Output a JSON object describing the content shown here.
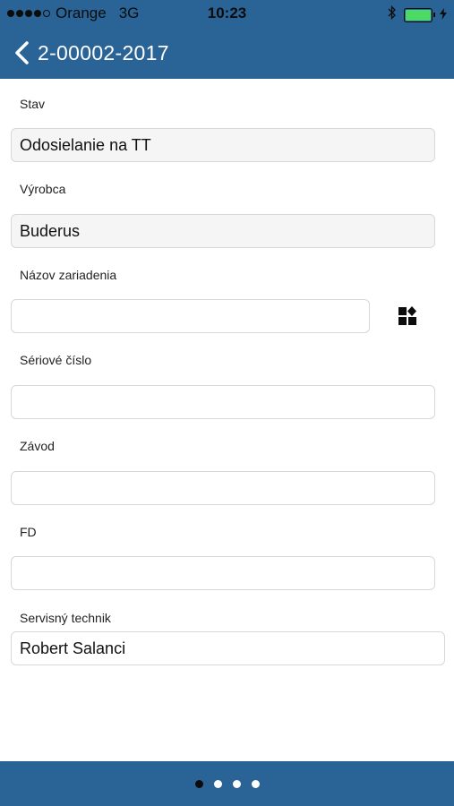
{
  "status_bar": {
    "carrier": "Orange",
    "network": "3G",
    "time": "10:23",
    "bluetooth_icon": "bluetooth-icon",
    "battery_icon": "battery-icon",
    "charge_icon": "charging-bolt-icon",
    "battery_color": "#4cd964"
  },
  "header": {
    "title": "2-00002-2017",
    "back_icon": "chevron-left-icon",
    "background": "#2a6496"
  },
  "form": {
    "stav": {
      "label": "Stav",
      "value": "Odosielanie na TT"
    },
    "vyrobca": {
      "label": "Výrobca",
      "value": "Buderus"
    },
    "nazov": {
      "label": "Názov zariadenia",
      "value": "",
      "action_icon": "grid-shapes-icon"
    },
    "seriove": {
      "label": "Sériové číslo",
      "value": ""
    },
    "zavod": {
      "label": "Závod",
      "value": ""
    },
    "fd": {
      "label": "FD",
      "value": ""
    },
    "technik": {
      "label": "Servisný technik",
      "value": "Robert Salanci"
    }
  },
  "pager": {
    "count": 4,
    "active_index": 0
  }
}
